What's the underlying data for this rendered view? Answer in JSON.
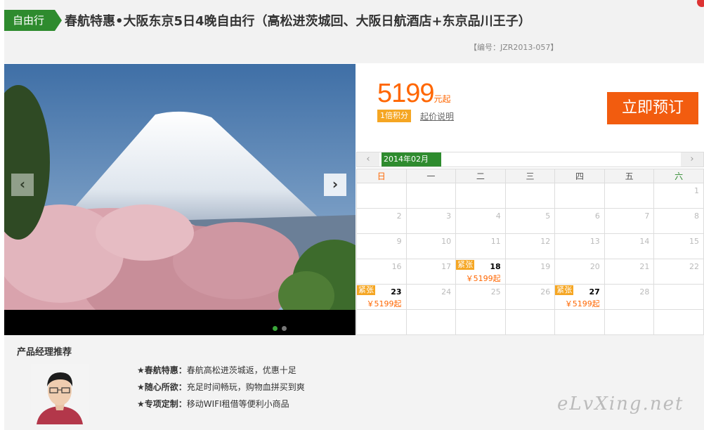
{
  "header": {
    "tag": "自由行",
    "title": "春航特惠•大阪东京5日4晚自由行（高松进茨城回、大阪日航酒店+东京品川王子）",
    "code": "【编号：JZR2013-057】"
  },
  "gallery": {
    "prev": "‹",
    "next": "›",
    "slide_count": 2,
    "active_slide": 1
  },
  "pricing": {
    "price": "5199",
    "unit": "元起",
    "points": "1倍积分",
    "price_note": "起价说明",
    "book_label": "立即预订"
  },
  "calendar": {
    "prev": "‹",
    "next": "›",
    "month": "2014年02月",
    "weekdays": [
      "日",
      "一",
      "二",
      "三",
      "四",
      "五",
      "六"
    ],
    "weeks": [
      [
        {
          "d": ""
        },
        {
          "d": ""
        },
        {
          "d": ""
        },
        {
          "d": ""
        },
        {
          "d": ""
        },
        {
          "d": ""
        },
        {
          "d": "1"
        }
      ],
      [
        {
          "d": "2"
        },
        {
          "d": "3"
        },
        {
          "d": "4"
        },
        {
          "d": "5"
        },
        {
          "d": "6"
        },
        {
          "d": "7"
        },
        {
          "d": "8"
        }
      ],
      [
        {
          "d": "9"
        },
        {
          "d": "10"
        },
        {
          "d": "11"
        },
        {
          "d": "12"
        },
        {
          "d": "13"
        },
        {
          "d": "14"
        },
        {
          "d": "15"
        }
      ],
      [
        {
          "d": "16"
        },
        {
          "d": "17"
        },
        {
          "d": "18",
          "tag": "紧张",
          "price": "￥5199起"
        },
        {
          "d": "19"
        },
        {
          "d": "20"
        },
        {
          "d": "21"
        },
        {
          "d": "22"
        }
      ],
      [
        {
          "d": "23",
          "tag": "紧张",
          "price": "￥5199起"
        },
        {
          "d": "24"
        },
        {
          "d": "25"
        },
        {
          "d": "26"
        },
        {
          "d": "27",
          "tag": "紧张",
          "price": "￥5199起"
        },
        {
          "d": "28"
        },
        {
          "d": ""
        }
      ],
      [
        {
          "d": ""
        },
        {
          "d": ""
        },
        {
          "d": ""
        },
        {
          "d": ""
        },
        {
          "d": ""
        },
        {
          "d": ""
        },
        {
          "d": ""
        }
      ]
    ]
  },
  "manager": {
    "title": "产品经理推荐",
    "items": [
      {
        "label": "★春航特惠：",
        "text": "春航高松进茨城返，优惠十足"
      },
      {
        "label": "★随心所欲：",
        "text": "充足时间畅玩，购物血拼买到爽"
      },
      {
        "label": "★专项定制：",
        "text": "移动WIFI租借等便利小商品"
      }
    ]
  },
  "watermark": "eLvXing.net",
  "colors": {
    "brand_green": "#2e8b2e",
    "price_orange": "#ff6600",
    "book_button": "#f25c0f",
    "tag_amber": "#f5a623"
  }
}
